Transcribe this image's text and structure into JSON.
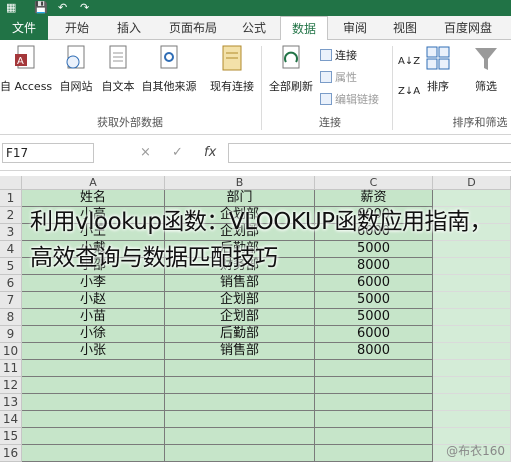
{
  "tabs": [
    "文件",
    "开始",
    "插入",
    "页面布局",
    "公式",
    "数据",
    "审阅",
    "视图",
    "百度网盘"
  ],
  "active_tab": "数据",
  "ribbon": {
    "get_external": {
      "buttons": [
        "自 Access",
        "自网站",
        "自文本",
        "自其他来源",
        "现有连接"
      ],
      "group_label": "获取外部数据"
    },
    "connections": {
      "refresh_all": "全部刷新",
      "connect": "连接",
      "properties": "属性",
      "edit_links": "编辑链接",
      "group_label": "连接"
    },
    "sort_filter": {
      "sort": "排序",
      "filter": "筛选",
      "group_label": "排序和筛选"
    }
  },
  "formula_bar": {
    "name_box": "F17",
    "cancel": "×",
    "enter": "✓",
    "fx": "fx"
  },
  "columns": [
    "A",
    "B",
    "C",
    "D"
  ],
  "rows": [
    "1",
    "2",
    "3",
    "4",
    "5",
    "6",
    "7",
    "8",
    "9",
    "10",
    "11",
    "12",
    "13",
    "14",
    "15",
    "16"
  ],
  "table": {
    "header": [
      "姓名",
      "部门",
      "薪资"
    ],
    "rows": [
      [
        "小高",
        "企划部",
        "6000"
      ],
      [
        "小王",
        "企划部",
        "6000"
      ],
      [
        "小戴",
        "后勤部",
        "5000"
      ],
      [
        "小邵",
        "财务部",
        "8000"
      ],
      [
        "小李",
        "销售部",
        "6000"
      ],
      [
        "小赵",
        "企划部",
        "5000"
      ],
      [
        "小苗",
        "企划部",
        "5000"
      ],
      [
        "小徐",
        "后勤部",
        "6000"
      ],
      [
        "小张",
        "销售部",
        "8000"
      ]
    ]
  },
  "caption": "利用vlookup函数：VLOOKUP函数应用指南，高效查询与数据匹配技巧",
  "watermark": "@布衣160",
  "colors": {
    "excel_green": "#217346",
    "cell_fill": "#c6e5c9"
  }
}
